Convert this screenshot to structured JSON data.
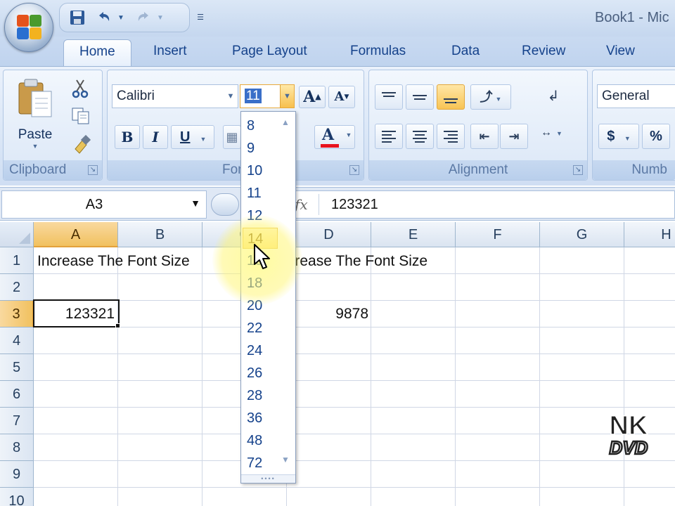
{
  "window": {
    "title": "Book1 - Mic"
  },
  "tabs": [
    "Home",
    "Insert",
    "Page Layout",
    "Formulas",
    "Data",
    "Review",
    "View"
  ],
  "ribbon": {
    "clipboard": {
      "paste_label": "Paste",
      "group_label": "Clipboard"
    },
    "font": {
      "font_name": "Calibri",
      "font_size": "11",
      "group_label": "Font"
    },
    "alignment": {
      "group_label": "Alignment"
    },
    "number": {
      "format": "General",
      "currency_symbol": "$",
      "percent_symbol": "%",
      "group_label": "Numb"
    }
  },
  "formula_bar": {
    "name_box": "A3",
    "fx_label": "fx",
    "formula": "123321"
  },
  "grid": {
    "columns": [
      "A",
      "B",
      "C",
      "D",
      "E",
      "F",
      "G",
      "H"
    ],
    "rows": [
      "1",
      "2",
      "3",
      "4",
      "5",
      "6",
      "7",
      "8",
      "9",
      "10"
    ],
    "selected_column": "A",
    "selected_row": "3",
    "cells": {
      "A1": "Increase The Font Size",
      "C1": "Decrease The Font Size",
      "A3": "123321",
      "D3": "9878"
    }
  },
  "font_size_dropdown": {
    "sizes": [
      "8",
      "9",
      "10",
      "11",
      "12",
      "14",
      "16",
      "18",
      "20",
      "22",
      "24",
      "26",
      "28",
      "36",
      "48",
      "72"
    ],
    "hovered": "14"
  },
  "watermark": {
    "line1": "NK",
    "line2": "DVD"
  },
  "colors": {
    "accent": "#15428b",
    "selection": "#f1c15f",
    "hover": "#ffe28a",
    "font_color_bar": "#e8121e",
    "highlight": "#fff35c"
  }
}
